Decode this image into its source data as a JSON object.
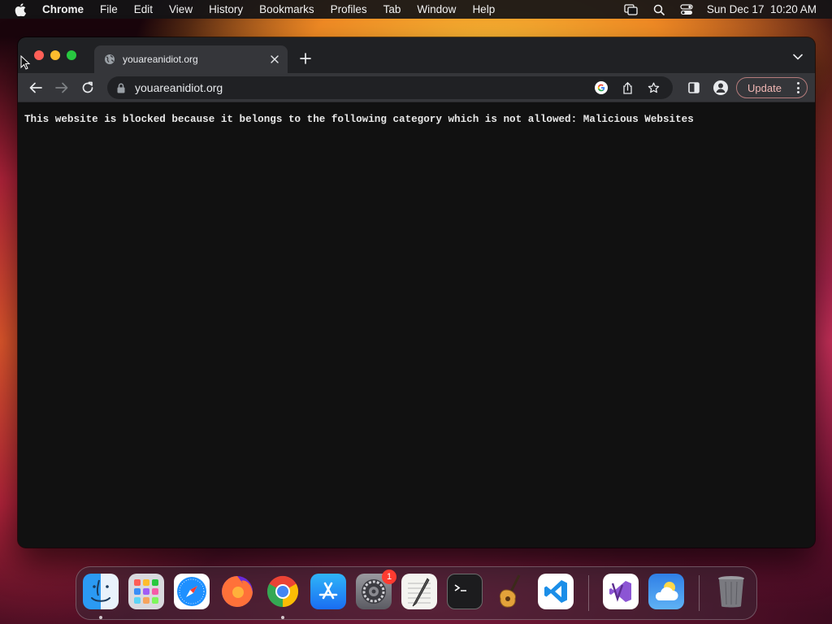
{
  "menubar": {
    "app_name": "Chrome",
    "menus": [
      "File",
      "Edit",
      "View",
      "History",
      "Bookmarks",
      "Profiles",
      "Tab",
      "Window",
      "Help"
    ],
    "datetime": "Sun Dec 17  10:20 AM"
  },
  "browser": {
    "tab": {
      "title": "youareanidiot.org"
    },
    "omnibox": {
      "url": "youareanidiot.org"
    },
    "update_label": "Update"
  },
  "page": {
    "message": "This website is blocked because it belongs to the following category which is not allowed: Malicious Websites"
  },
  "dock": {
    "apps": [
      {
        "name": "Finder",
        "icon": "finder-icon"
      },
      {
        "name": "Launchpad",
        "icon": "launchpad-icon"
      },
      {
        "name": "Safari",
        "icon": "safari-icon"
      },
      {
        "name": "Firefox",
        "icon": "firefox-icon"
      },
      {
        "name": "Google Chrome",
        "icon": "chrome-icon"
      },
      {
        "name": "App Store",
        "icon": "app-store-icon"
      },
      {
        "name": "System Settings",
        "icon": "settings-icon",
        "badge": "1"
      },
      {
        "name": "TextEdit",
        "icon": "textedit-icon"
      },
      {
        "name": "Terminal",
        "icon": "terminal-icon"
      },
      {
        "name": "GarageBand",
        "icon": "garageband-icon"
      },
      {
        "name": "Visual Studio Code",
        "icon": "vscode-icon"
      },
      {
        "name": "Visual Studio",
        "icon": "visual-studio-icon"
      },
      {
        "name": "Weather",
        "icon": "weather-icon"
      },
      {
        "name": "Trash",
        "icon": "trash-icon"
      }
    ]
  },
  "colors": {
    "window_bg": "#111111",
    "tab_active": "#35363a",
    "update_border": "#b57b7b"
  }
}
